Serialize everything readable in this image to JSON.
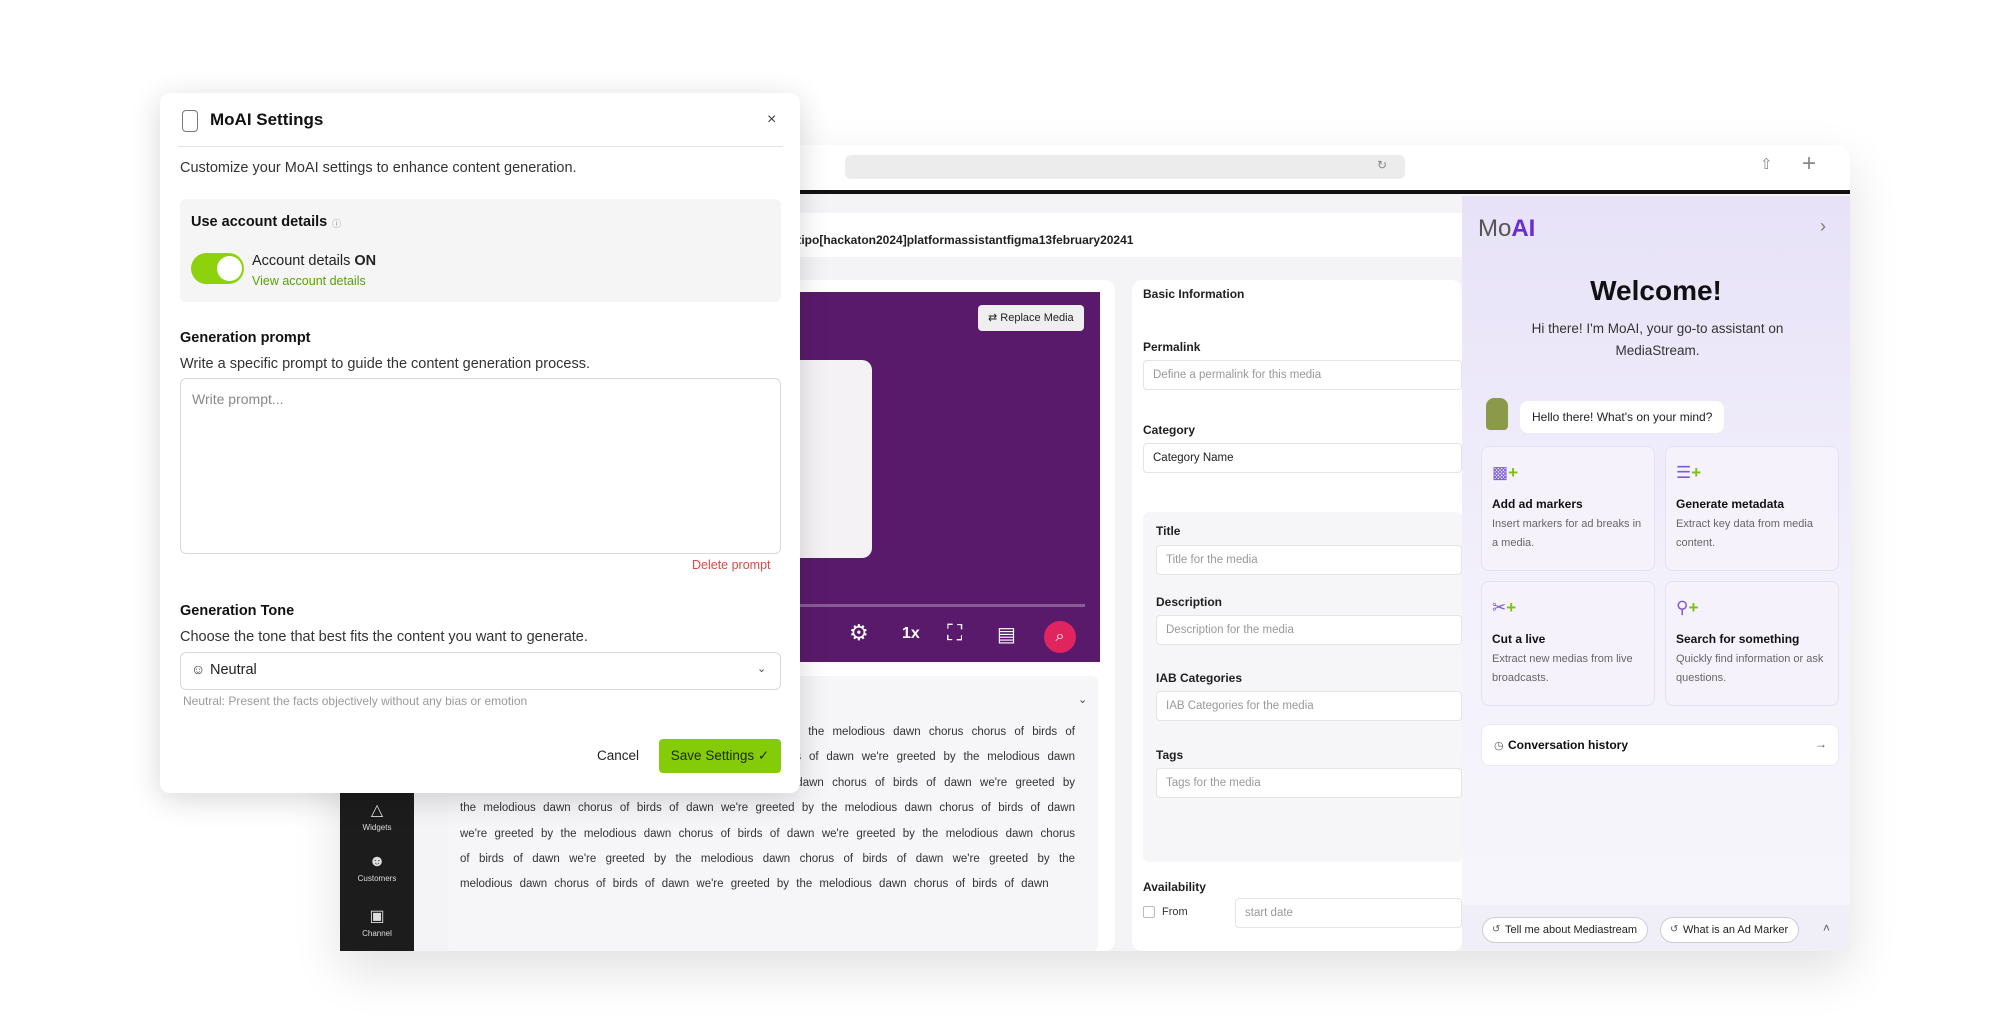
{
  "browser": {
    "reload_icon": "reload-icon",
    "share_icon": "share-icon",
    "new_tab_icon": "plus-icon"
  },
  "path": {
    "text": "otipo[hackaton2024]platformassistantfigma13february20241"
  },
  "sidebar": {
    "items": [
      {
        "label": "Widgets",
        "icon": "widgets-icon"
      },
      {
        "label": "Customers",
        "icon": "customers-icon"
      },
      {
        "label": "Channel",
        "icon": "channel-icon"
      }
    ]
  },
  "media": {
    "replace_label": "Replace Media",
    "speed": "1x",
    "description_text": "ous dawn chorus of birds of dawn we're we're greeted by the melodious dawn chorus chorus of birds of dawn we're greeted by the melodious dawn chorus of birds of dawn we're greeted by the melodious dawn chorus of birds of dawn we're greeted by the melodious dawn chorus of birds of dawn we're greeted by the melodious dawn chorus of birds of dawn we're greeted by the melodious dawn chorus of birds of dawn we're greeted by the melodious dawn chorus of birds of dawn we're greeted by the melodious dawn chorus of birds of dawn we're greeted by the melodious dawn chorus of birds of dawn we're greeted by the melodious dawn chorus of birds of dawn we're greeted by the melodious dawn chorus of birds of dawn"
  },
  "basic_info": {
    "heading": "Basic Information",
    "permalink_label": "Permalink",
    "permalink_placeholder": "Define a permalink for this media",
    "category_label": "Category",
    "category_value": "Category Name",
    "title_label": "Title",
    "title_placeholder": "Title for the media",
    "description_label": "Description",
    "description_placeholder": "Description for the media",
    "iab_label": "IAB Categories",
    "iab_placeholder": "IAB Categories for the media",
    "tags_label": "Tags",
    "tags_placeholder": "Tags for the media",
    "availability_label": "Availability",
    "from_label": "From",
    "start_placeholder": "start date"
  },
  "moai": {
    "logo_prefix": "Mo",
    "logo_suffix": "AI",
    "welcome": "Welcome!",
    "intro": "Hi there! I'm MoAI, your go-to assistant on MediaStream.",
    "bubble": "Hello there! What's on your mind?",
    "cards": [
      {
        "title": "Add ad markers",
        "desc": "Insert markers for ad breaks in a media.",
        "icon": "ad-marker-icon"
      },
      {
        "title": "Generate metadata",
        "desc": "Extract key data from media content.",
        "icon": "list-add-icon"
      },
      {
        "title": "Cut a live",
        "desc": "Extract new medias from live broadcasts.",
        "icon": "scissors-icon"
      },
      {
        "title": "Search for something",
        "desc": "Quickly find information or ask questions.",
        "icon": "search-icon"
      }
    ],
    "history_label": "Conversation history",
    "chips": [
      "Tell me about Mediastream",
      "What is an Ad Marker"
    ]
  },
  "modal": {
    "title": "MoAI Settings",
    "subtitle": "Customize your MoAI settings to enhance content generation.",
    "account_heading": "Use account details",
    "account_toggle_text": "Account details ",
    "account_toggle_state": "ON",
    "account_link": "View account details",
    "prompt_heading": "Generation prompt",
    "prompt_sub": "Write a specific prompt to guide the content generation process.",
    "prompt_placeholder": "Write prompt...",
    "prompt_value": "",
    "delete_prompt": "Delete prompt",
    "tone_heading": "Generation Tone",
    "tone_sub": "Choose the tone that best fits the content you want to generate.",
    "tone_value": "Neutral",
    "tone_hint": "Neutral: Present the facts objectively without any bias or emotion",
    "cancel": "Cancel",
    "save": "Save Settings"
  },
  "colors": {
    "accent_green": "#84cc0a",
    "moai_purple": "#6a2bd9",
    "video_purple": "#5a1a6b",
    "danger_red": "#e04848"
  }
}
